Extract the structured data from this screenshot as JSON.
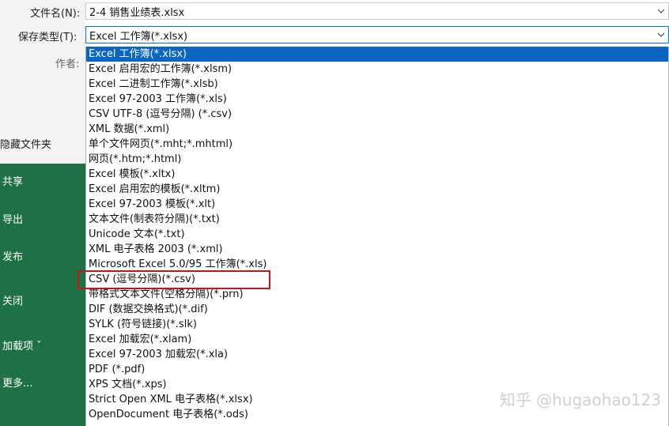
{
  "labels": {
    "filename": "文件名(N):",
    "savetype": "保存类型(T):",
    "author": "作者:"
  },
  "filename": {
    "value": "2-4 销售业绩表.xlsx"
  },
  "savetype": {
    "value": "Excel 工作簿(*.xlsx)"
  },
  "sidebar": {
    "hide_folders": "隐藏文件夹",
    "items": [
      "共享",
      "导出",
      "发布",
      "关闭",
      "加载项 ˇ",
      "更多..."
    ]
  },
  "dropdown": {
    "selected_index": 0,
    "highlighted_index": 15,
    "items": [
      "Excel 工作簿(*.xlsx)",
      "Excel 启用宏的工作簿(*.xlsm)",
      "Excel 二进制工作簿(*.xlsb)",
      "Excel 97-2003 工作簿(*.xls)",
      "CSV UTF-8 (逗号分隔) (*.csv)",
      "XML 数据(*.xml)",
      "单个文件网页(*.mht;*.mhtml)",
      "网页(*.htm;*.html)",
      "Excel 模板(*.xltx)",
      "Excel 启用宏的模板(*.xltm)",
      "Excel 97-2003 模板(*.xlt)",
      "文本文件(制表符分隔)(*.txt)",
      "Unicode 文本(*.txt)",
      "XML 电子表格 2003 (*.xml)",
      "Microsoft Excel 5.0/95 工作簿(*.xls)",
      "CSV (逗号分隔)(*.csv)",
      "带格式文本文件(空格分隔)(*.prn)",
      "DIF (数据交换格式)(*.dif)",
      "SYLK (符号链接)(*.slk)",
      "Excel 加载宏(*.xlam)",
      "Excel 97-2003 加载宏(*.xla)",
      "PDF (*.pdf)",
      "XPS 文档(*.xps)",
      "Strict Open XML 电子表格(*.xlsx)",
      "OpenDocument 电子表格(*.ods)"
    ]
  },
  "icons": {
    "dropdown_chevron": "chevron-down-icon"
  },
  "colors": {
    "selection_blue": "#0a66c2",
    "sidebar_green": "#1e7145",
    "highlight_red": "#c01818"
  },
  "watermark": "知乎 @hugaohao123"
}
